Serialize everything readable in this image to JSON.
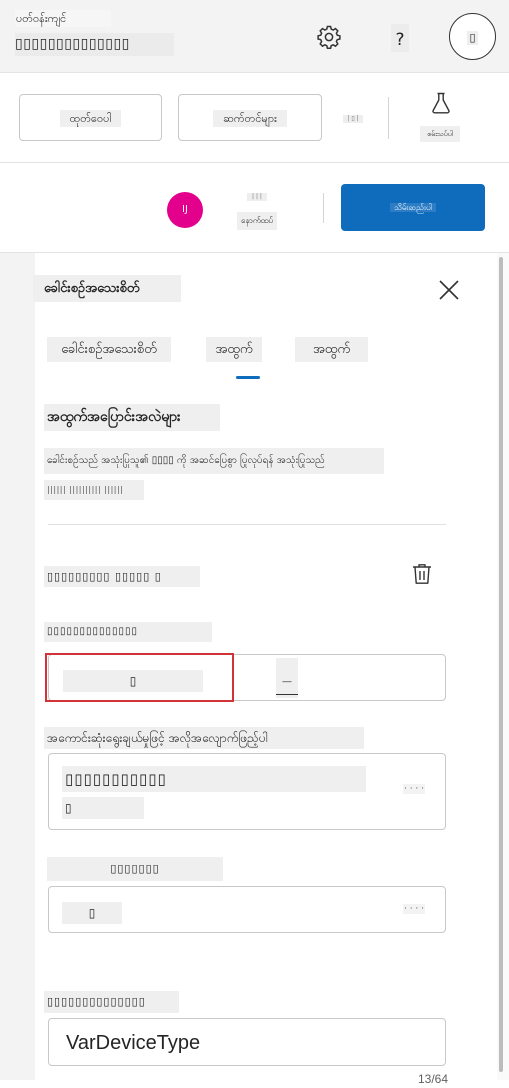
{
  "header": {
    "app_subtitle": "ပတ်ဝန်းကျင်",
    "app_title": "▯▯▯▯▯▯▯▯▯▯▯▯▯▯",
    "help_label": "?",
    "avatar_label": "▯"
  },
  "toolbar": {
    "edit_label": "ထုတ်ဝေပါ",
    "next_label": "ဆက်တင်များ",
    "mini_label": "| ▯ |",
    "test_label": "စမ်းသပ်ပါ"
  },
  "row2": {
    "avatar_initials": "IJ",
    "presence_top": "| | |",
    "presence_label": "နောက်ထပ်",
    "publish_label": "သိမ်းဆည်းပါ"
  },
  "panel": {
    "title": "ခေါင်းစဉ်အသေးစိတ်",
    "tabs": [
      "ခေါင်းစဉ်အသေးစိတ်",
      "အထွက်",
      "အထွက်"
    ],
    "active_tab_index": 1,
    "section_title": "အထွက်အပြောင်းအလဲများ",
    "section_desc": "ခေါင်းစဉ်သည် အသုံးပြုသူ၏ ▯▯▯▯ ကို အဆင်ပြေစွာ ပြုလုပ်ရန် အသုံးပြုသည်",
    "section_link": "|||||| |||||||||| ||||||",
    "variable_heading": "▯▯▯▯▯▯▯▯▯ ▯▯▯▯▯ ▯",
    "name_label": "▯▯▯▯▯▯▯▯▯▯▯▯▯▯",
    "name_left": "▯",
    "name_right": "__",
    "choice_label": "အကောင်းဆုံးရွေးချယ်မှုဖြင့် အလိုအလျောက်ဖြည့်ပါ",
    "choice_line1": "▯▯▯▯▯▯▯▯▯▯▯",
    "choice_line2": "▯",
    "dots": "· · · ·",
    "type_label": "▯▯▯▯▯▯▯",
    "type_value": "▯",
    "var_label": "▯▯▯▯▯▯▯▯▯▯▯▯▯▯",
    "var_value": "VarDeviceType",
    "var_count": "13/64"
  },
  "colors": {
    "accent": "#0f6cbd",
    "avatar_pink": "#e3008c",
    "highlight_red": "#d13438"
  },
  "icons": [
    "gear-icon",
    "help-icon",
    "flask-icon",
    "close-icon",
    "trash-icon"
  ]
}
